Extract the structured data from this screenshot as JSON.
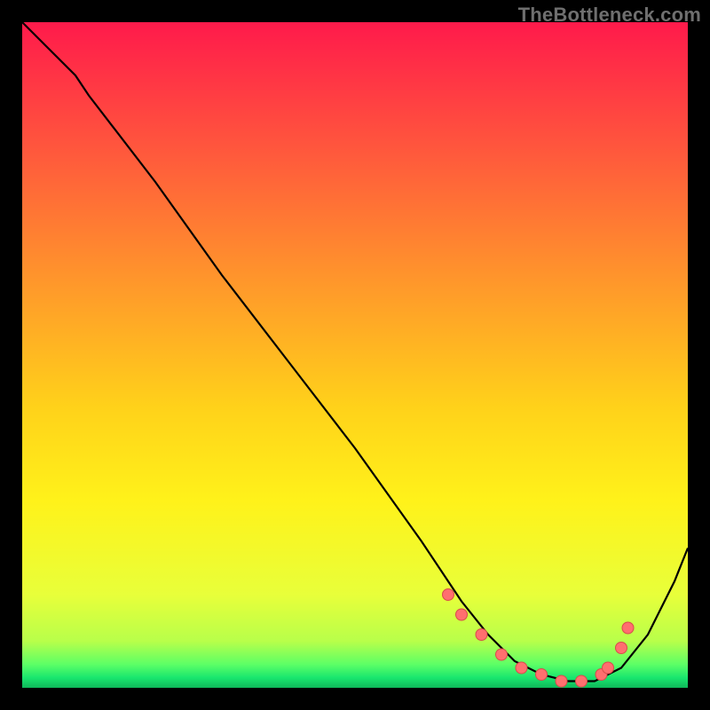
{
  "watermark": "TheBottleneck.com",
  "colors": {
    "background": "#000000",
    "gradient_stops": [
      {
        "offset": 0.0,
        "color": "#ff1a4b"
      },
      {
        "offset": 0.2,
        "color": "#ff5a3c"
      },
      {
        "offset": 0.4,
        "color": "#ff9a2a"
      },
      {
        "offset": 0.58,
        "color": "#ffd21a"
      },
      {
        "offset": 0.72,
        "color": "#fff21a"
      },
      {
        "offset": 0.86,
        "color": "#e8ff3a"
      },
      {
        "offset": 0.93,
        "color": "#b8ff4a"
      },
      {
        "offset": 0.965,
        "color": "#5cff66"
      },
      {
        "offset": 0.985,
        "color": "#19e66e"
      },
      {
        "offset": 1.0,
        "color": "#0fb85a"
      }
    ],
    "curve": "#000000",
    "markers_fill": "#ff6f6f",
    "markers_stroke": "#d94b4b"
  },
  "chart_data": {
    "type": "line",
    "title": "",
    "xlabel": "",
    "ylabel": "",
    "xlim": [
      0,
      100
    ],
    "ylim": [
      0,
      100
    ],
    "series": [
      {
        "name": "bottleneck-curve",
        "x": [
          0,
          4,
          8,
          10,
          20,
          30,
          40,
          50,
          60,
          66,
          70,
          74,
          78,
          82,
          86,
          90,
          94,
          98,
          100
        ],
        "y": [
          100,
          96,
          92,
          89,
          76,
          62,
          49,
          36,
          22,
          13,
          8,
          4,
          2,
          1,
          1,
          3,
          8,
          16,
          21
        ]
      }
    ],
    "markers": {
      "name": "highlighted-points",
      "x": [
        64,
        66,
        69,
        72,
        75,
        78,
        81,
        84,
        87,
        88,
        90,
        91
      ],
      "y": [
        14,
        11,
        8,
        5,
        3,
        2,
        1,
        1,
        2,
        3,
        6,
        9
      ]
    }
  }
}
